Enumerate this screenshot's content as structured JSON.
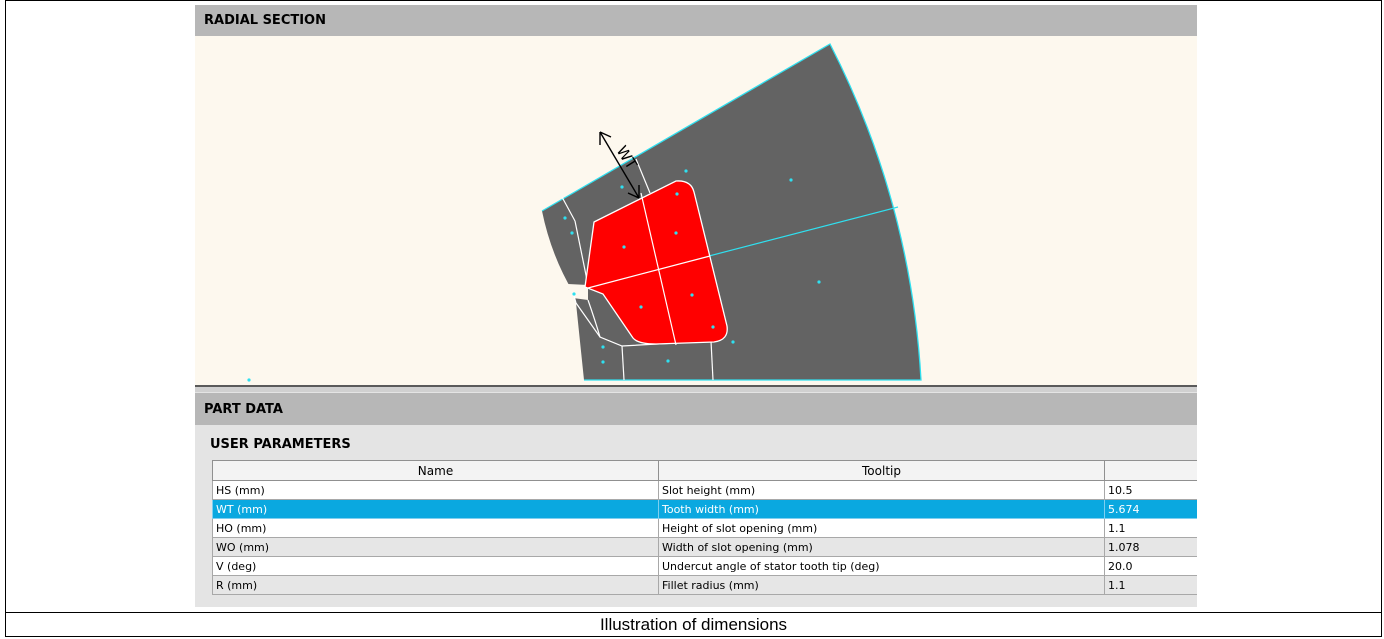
{
  "radial_section": {
    "title": "RADIAL SECTION",
    "dimension_label": "WT"
  },
  "part_data": {
    "title": "PART DATA",
    "user_parameters": {
      "title": "USER PARAMETERS",
      "columns": [
        "Name",
        "Tooltip",
        ""
      ],
      "rows": [
        {
          "name": "HS (mm)",
          "tooltip": "Slot height (mm)",
          "value": "10.5"
        },
        {
          "name": "WT (mm)",
          "tooltip": "Tooth width (mm)",
          "value": "5.674"
        },
        {
          "name": "HO (mm)",
          "tooltip": "Height of slot opening (mm)",
          "value": "1.1"
        },
        {
          "name": "WO (mm)",
          "tooltip": "Width of slot opening (mm)",
          "value": "1.078"
        },
        {
          "name": "V (deg)",
          "tooltip": "Undercut angle of stator tooth tip (deg)",
          "value": "20.0"
        },
        {
          "name": "R (mm)",
          "tooltip": "Fillet radius (mm)",
          "value": "1.1"
        }
      ],
      "selected_row": 1
    }
  },
  "caption": "Illustration of dimensions",
  "colors": {
    "header_bg": "#b7b7b7",
    "canvas_bg": "#fdf8ee",
    "stator_fill": "#636363",
    "slot_fill": "#ff0000",
    "boundary": "#2fe0f0",
    "selection": "#0aa8e0"
  }
}
